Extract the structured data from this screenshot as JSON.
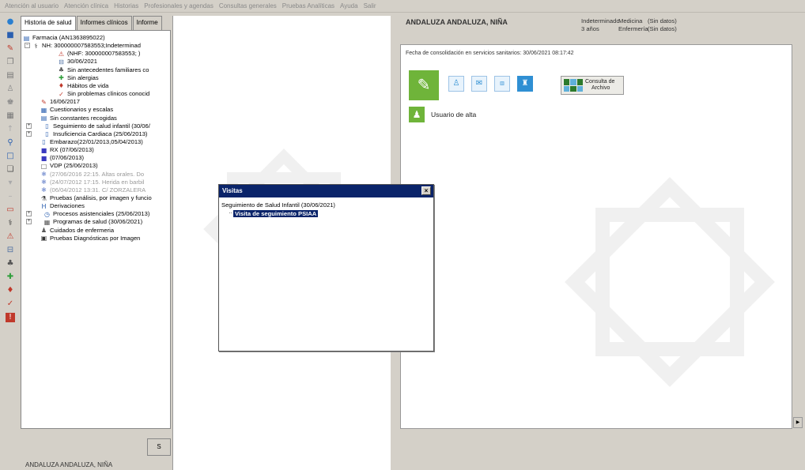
{
  "menu": [
    "Atención al usuario",
    "Atención clínica",
    "Historias",
    "Profesionales y agendas",
    "Consultas generales",
    "Pruebas Analíticas",
    "Ayuda",
    "Salir"
  ],
  "tabs": [
    "Historia de salud",
    "Informes clínicos",
    "Informe"
  ],
  "tree": {
    "nodes": [
      {
        "text": "Farmacia (AN1363895022)",
        "icon": "pharmacy-icon",
        "glyph": "▤",
        "color": "#2a5fb0"
      },
      {
        "text": "NH: 300000007583553;Indeterminad",
        "icon": "stethoscope-icon",
        "glyph": "⚕",
        "color": "#333"
      },
      {
        "text": "(NHF: 300000007583553; )",
        "icon": "warning-person-icon",
        "glyph": "⚠",
        "color": "#c0392b"
      },
      {
        "text": "30/06/2021",
        "icon": "bed-icon",
        "glyph": "⊟",
        "color": "#4a6ca0"
      },
      {
        "text": "Sin antecedentes familiares co",
        "icon": "family-icon",
        "glyph": "♣",
        "color": "#555"
      },
      {
        "text": "Sin alergias",
        "icon": "allergy-icon",
        "glyph": "✚",
        "color": "#2e9e3a"
      },
      {
        "text": "Hábitos de vida",
        "icon": "lifestyle-icon",
        "glyph": "♦",
        "color": "#c0392b"
      },
      {
        "text": "Sin problemas clínicos conocid",
        "icon": "clinical-problems-icon",
        "glyph": "✓",
        "color": "#c0392b"
      },
      {
        "text": "16/06/2017",
        "icon": "pencil-icon",
        "glyph": "✎",
        "color": "#c0392b"
      },
      {
        "text": "Cuestionarios y escalas",
        "icon": "questionnaire-icon",
        "glyph": "▦",
        "color": "#2a5fb0"
      },
      {
        "text": "Sin constantes recogidas",
        "icon": "vitals-icon",
        "glyph": "▤",
        "color": "#2a5fb0"
      },
      {
        "text": "Seguimiento de salud infantil (30/06/",
        "icon": "child-health-icon",
        "glyph": "▯",
        "color": "#2a5fb0"
      },
      {
        "text": "Insuficiencia Cardiaca (25/06/2013)",
        "icon": "heart-failure-icon",
        "glyph": "▯",
        "color": "#2a5fb0"
      },
      {
        "text": "Embarazo(22/01/2013,05/04/2013)",
        "icon": "pregnancy-icon",
        "glyph": "▯",
        "color": "#2a5fb0"
      },
      {
        "text": "RX (07/06/2013)",
        "icon": "xray-icon",
        "glyph": "■",
        "color": "#3a3ac0"
      },
      {
        "text": "(07/06/2013)",
        "icon": "xray-icon-2",
        "glyph": "■",
        "color": "#3a3ac0"
      },
      {
        "text": "VDP (25/06/2013)",
        "icon": "vdp-icon",
        "glyph": "□",
        "color": "#555"
      },
      {
        "text": "(27/06/2016 22:15. Altas orales. Do",
        "icon": "visit-gear-icon",
        "glyph": "✱",
        "color": "#8fa3d8",
        "grey": true
      },
      {
        "text": "(24/07/2012 17:15. Herida en barbil",
        "icon": "visit-gear-icon-2",
        "glyph": "✱",
        "color": "#8fa3d8",
        "grey": true
      },
      {
        "text": "(06/04/2012 13:31. C/ ZORZALERA",
        "icon": "visit-gear-icon-3",
        "glyph": "✱",
        "color": "#8fa3d8",
        "grey": true
      },
      {
        "text": "Pruebas (análisis, por imagen y funcio",
        "icon": "tests-icon",
        "glyph": "⚗",
        "color": "#333"
      },
      {
        "text": "Derivaciones",
        "icon": "referrals-h-icon",
        "glyph": "H",
        "color": "#2a5fb0"
      },
      {
        "text": "Procesos asistenciales (25/06/2013)",
        "icon": "care-process-icon",
        "glyph": "◷",
        "color": "#2a5fb0"
      },
      {
        "text": "Programas de salud (30/06/2021)",
        "icon": "health-programs-icon",
        "glyph": "▦",
        "color": "#555"
      },
      {
        "text": "Cuidados de enfermeria",
        "icon": "nursing-icon",
        "glyph": "♟",
        "color": "#555"
      },
      {
        "text": "Pruebas Diagnósticas por Imagen",
        "icon": "imaging-icon",
        "glyph": "▣",
        "color": "#333"
      }
    ]
  },
  "left_button_label": "S",
  "status_name": "ANDALUZA ANDALUZA, NIÑA",
  "patient": {
    "name": "ANDALUZA ANDALUZA, NIÑA",
    "sex": "Indeterminado",
    "age": "3 años",
    "medicina_label": "Medicina",
    "enfermeria_label": "Enfermería",
    "medicina_value": "(Sin datos)",
    "enfermeria_value": "(Sin datos)"
  },
  "consolidacion_text": "Fecha de consolidación en servicios sanitarios: 30/06/2021 08:17:42",
  "archivo_label_1": "Consulta de",
  "archivo_label_2": "Archivo",
  "usuario_label": "Usuario de alta",
  "dialog": {
    "title": "Visitas",
    "close": "×",
    "parent": "Seguimiento de Salud Infantil (30/06/2021)",
    "selected_item": "Visita de seguimiento PSIAA"
  },
  "colors": {
    "title_bar": "#0a246a",
    "green_accent": "#6fb43a",
    "chrome": "#d4d0c8"
  }
}
